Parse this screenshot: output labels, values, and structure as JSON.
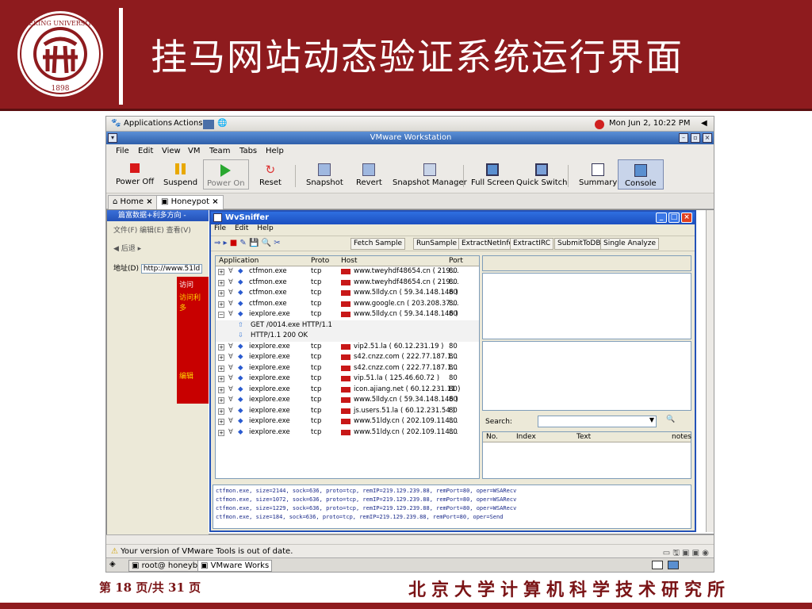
{
  "slide": {
    "title": "挂马网站动态验证系统运行界面",
    "logo_text": "PEKING UNIVERSITY 1898",
    "page_label": "第 18 页/共 31 页",
    "institute": "北京大学计算机科学技术研究所"
  },
  "panel": {
    "applications": "Applications",
    "actions": "Actions",
    "clock": "Mon Jun  2, 10:22 PM"
  },
  "vmware": {
    "title": "VMware Workstation",
    "menu": [
      "File",
      "Edit",
      "View",
      "VM",
      "Team",
      "Tabs",
      "Help"
    ],
    "toolbar": [
      "Power Off",
      "Suspend",
      "Power On",
      "Reset",
      "Snapshot",
      "Revert",
      "Snapshot Manager",
      "Full Screen",
      "Quick Switch",
      "Summary",
      "Console"
    ],
    "tabs": [
      "Home",
      "Honeypot"
    ],
    "status": "Your version of VMware Tools is out of date.",
    "taskbar": [
      "root@ honeybot",
      "VMware Works"
    ]
  },
  "ie": {
    "title": "篇富数据+利多方向 -",
    "menu": "文件(F)  编辑(E)  查看(V)",
    "back": "后退",
    "address_label": "地址(D)",
    "address": "http://www.51ld",
    "banner1": "访问",
    "banner2": "访问利多",
    "side": "编辑"
  },
  "sniffer": {
    "title": "WvSniffer",
    "menu": [
      "File",
      "Edit",
      "Help"
    ],
    "tools": [
      "Fetch Sample",
      "RunSample",
      "ExtractNetInfo",
      "ExtractIRC",
      "SubmitToDB",
      "Single Analyze"
    ],
    "columns": [
      "Application",
      "Proto",
      "Host",
      "Port"
    ],
    "rows": [
      {
        "app": "ctfmon.exe",
        "proto": "tcp",
        "host": "www.tweyhdf48654.cn ( 219....",
        "port": "80"
      },
      {
        "app": "ctfmon.exe",
        "proto": "tcp",
        "host": "www.tweyhdf48654.cn ( 219....",
        "port": "80"
      },
      {
        "app": "ctfmon.exe",
        "proto": "tcp",
        "host": "www.5lldy.cn ( 59.34.148.146 )",
        "port": "80"
      },
      {
        "app": "ctfmon.exe",
        "proto": "tcp",
        "host": "www.google.cn ( 203.208.37....",
        "port": "80"
      },
      {
        "app": "iexplore.exe",
        "proto": "tcp",
        "host": "www.5lldy.cn ( 59.34.148.146 )",
        "port": "80"
      },
      {
        "app": "GET /0014.exe HTTP/1.1",
        "proto": "",
        "host": "",
        "port": ""
      },
      {
        "app": "HTTP/1.1 200 OK",
        "proto": "",
        "host": "",
        "port": ""
      },
      {
        "app": "iexplore.exe",
        "proto": "tcp",
        "host": "vip2.51.la ( 60.12.231.19 )",
        "port": "80"
      },
      {
        "app": "iexplore.exe",
        "proto": "tcp",
        "host": "s42.cnzz.com ( 222.77.187.1...",
        "port": "80"
      },
      {
        "app": "iexplore.exe",
        "proto": "tcp",
        "host": "s42.cnzz.com ( 222.77.187.1...",
        "port": "80"
      },
      {
        "app": "iexplore.exe",
        "proto": "tcp",
        "host": "vip.51.la ( 125.46.60.72 )",
        "port": "80"
      },
      {
        "app": "iexplore.exe",
        "proto": "tcp",
        "host": "icon.ajiang.net ( 60.12.231.11 )",
        "port": "80"
      },
      {
        "app": "iexplore.exe",
        "proto": "tcp",
        "host": "www.5lldy.cn ( 59.34.148.146 )",
        "port": "80"
      },
      {
        "app": "iexplore.exe",
        "proto": "tcp",
        "host": "js.users.51.la ( 60.12.231.54 )",
        "port": "80"
      },
      {
        "app": "iexplore.exe",
        "proto": "tcp",
        "host": "www.51ldy.cn ( 202.109.114....",
        "port": "80"
      },
      {
        "app": "iexplore.exe",
        "proto": "tcp",
        "host": "www.51ldy.cn ( 202.109.114....",
        "port": "80"
      }
    ],
    "search_label": "Search:",
    "result_columns": [
      "No.",
      "Index",
      "Text",
      "notes"
    ],
    "log": [
      "ctfmon.exe, size=2144, sock=636, proto=tcp, remIP=219.129.239.88, remPort=80, oper=WSARecv",
      "ctfmon.exe, size=1072, sock=636, proto=tcp, remIP=219.129.239.88, remPort=80, oper=WSARecv",
      "ctfmon.exe, size=1229, sock=636, proto=tcp, remIP=219.129.239.88, remPort=80, oper=WSARecv",
      "ctfmon.exe, size=184, sock=636, proto=tcp, remIP=219.129.239.88, remPort=80, oper=Send"
    ]
  }
}
